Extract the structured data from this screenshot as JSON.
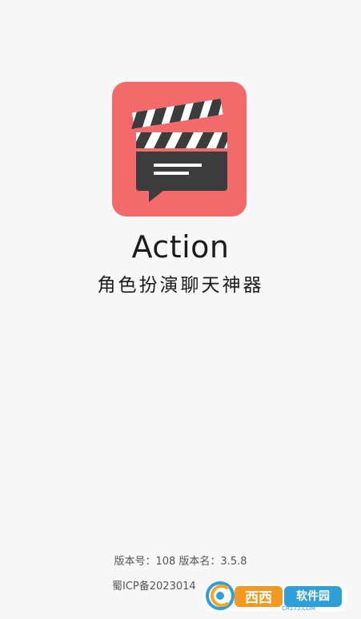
{
  "app": {
    "title": "Action",
    "subtitle": "角色扮演聊天神器",
    "version_info": "版本号：108 版本名：3.5.8",
    "icp": "蜀ICP备2023014",
    "icon": "clapperboard-chat-icon"
  },
  "watermark": {
    "text": "西西软件园",
    "domain": "CR173.COM",
    "icon": "cr173-logo"
  },
  "colors": {
    "background": "#f7f7f7",
    "icon_background": "#f26a6a",
    "clapper_dark": "#3c3c3c",
    "text_primary": "#1c1c1c",
    "text_secondary": "#555555"
  }
}
